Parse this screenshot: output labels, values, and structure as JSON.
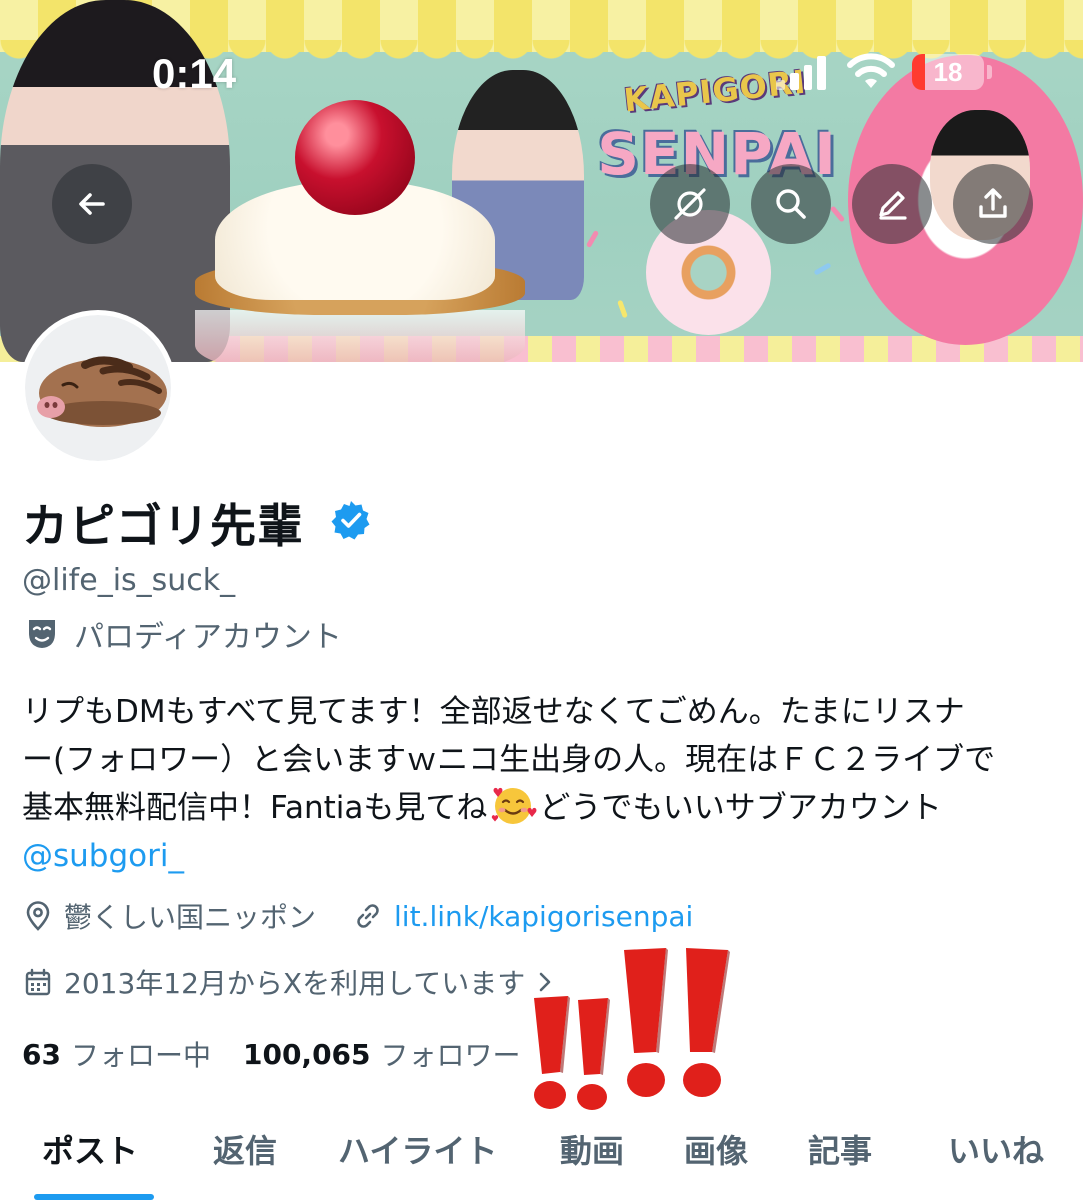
{
  "status_bar": {
    "time": "0:14",
    "battery": "18",
    "battery_percent": 18
  },
  "banner": {
    "logo_line1": "KAPIGORI",
    "logo_line2": "SENPAI"
  },
  "header_buttons": [
    {
      "name": "back",
      "icon": "arrow-left-icon"
    },
    {
      "name": "grok",
      "icon": "grok-icon"
    },
    {
      "name": "search",
      "icon": "search-icon"
    },
    {
      "name": "edit",
      "icon": "pencil-icon"
    },
    {
      "name": "share",
      "icon": "share-icon"
    }
  ],
  "profile": {
    "display_name": "カピゴリ先輩",
    "verified": true,
    "handle": "@life_is_suck_",
    "label": "パロディアカウント",
    "bio_line1": "リプもDMもすべて見てます！全部返せなくてごめん。たまにリスナ",
    "bio_line2": "ー(フォロワー）と会いますｗニコ生出身の人。現在はＦＣ２ライブで",
    "bio_line3_before": "基本無料配信中！Fantiaも見てね",
    "bio_line3_after": "どうでもいいサブアカウント",
    "bio_mention": "@subgori_",
    "location": "鬱くしい国ニッポン",
    "link": "lit.link/kapigorisenpai",
    "joined": "2013年12月からXを利用しています",
    "following_count": "63",
    "following_label": "フォロー中",
    "followers_count": "100,065",
    "followers_label": "フォロワー"
  },
  "tabs": [
    {
      "label": "ポスト",
      "active": true
    },
    {
      "label": "返信",
      "active": false
    },
    {
      "label": "ハイライト",
      "active": false
    },
    {
      "label": "動画",
      "active": false
    },
    {
      "label": "画像",
      "active": false
    },
    {
      "label": "記事",
      "active": false
    },
    {
      "label": "いいね",
      "active": false
    }
  ],
  "colors": {
    "accent": "#1d9bf0",
    "text_primary": "#0f1419",
    "text_secondary": "#536471",
    "exclamation": "#e0201b"
  }
}
